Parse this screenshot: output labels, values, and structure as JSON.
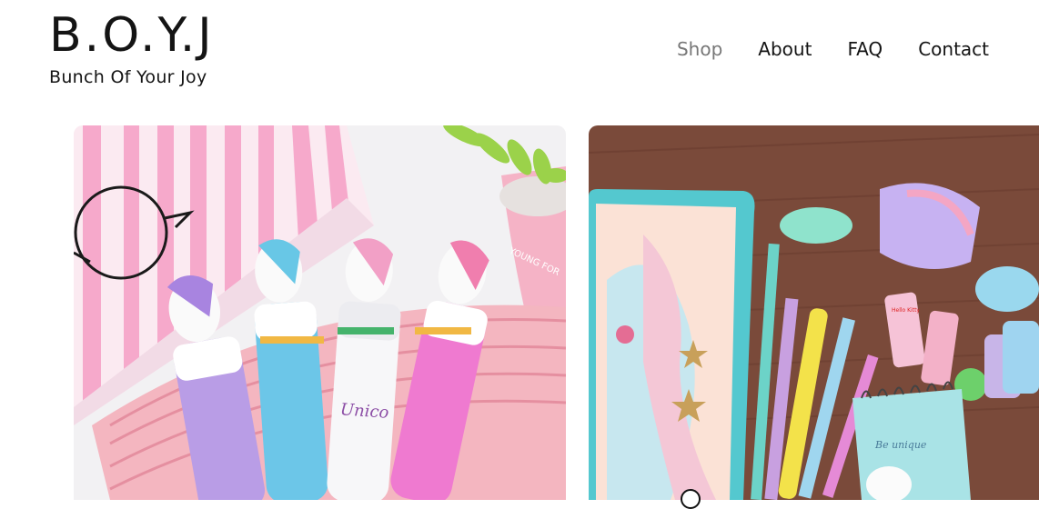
{
  "brand": {
    "title": "B.O.Y.J",
    "subtitle": "Bunch Of Your Joy"
  },
  "nav": {
    "items": [
      {
        "label": "Shop",
        "active": true
      },
      {
        "label": "About",
        "active": false
      },
      {
        "label": "FAQ",
        "active": false
      },
      {
        "label": "Contact",
        "active": false
      }
    ]
  },
  "gallery": {
    "images": [
      {
        "name": "unicorn-pens-photo",
        "pen_text_1": "Unico"
      },
      {
        "name": "unicorn-stationery-photo",
        "notebook_text": "Be unique",
        "pink_box_text_1": "Hello Kitty"
      }
    ]
  },
  "colors": {
    "text": "#141414",
    "nav_active": "#777777",
    "background": "#ffffff"
  }
}
